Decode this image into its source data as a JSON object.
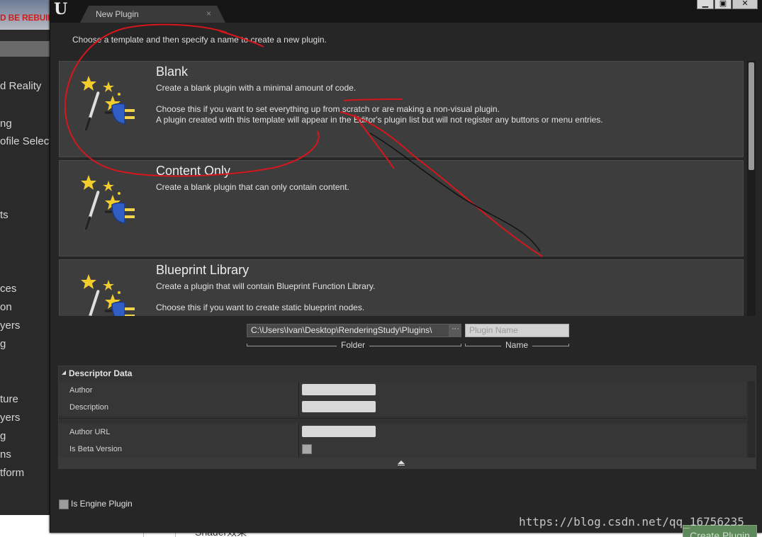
{
  "background": {
    "warning_text": "D BE REBUILT",
    "labels": [
      "d Reality",
      "ng",
      "ofile Select",
      "ts",
      "ces",
      "on",
      "yers",
      "g",
      "ture",
      "yers",
      "g",
      "ns",
      "tform"
    ],
    "below_text": "Shader效果"
  },
  "window": {
    "tab_title": "New Plugin",
    "tab_close": "×",
    "min_glyph": "▁",
    "max_glyph": "▣",
    "close_glyph": "✕",
    "logo": "U"
  },
  "instructions": "Choose a template and then specify a name to create a new plugin.",
  "templates": [
    {
      "name": "Blank",
      "description": "Create a blank plugin with a minimal amount of code.\n\nChoose this if you want to set everything up from scratch or are making a non-visual plugin.\nA plugin created with this template will appear in the Editor's plugin list but will not register any buttons or menu entries."
    },
    {
      "name": "Content Only",
      "description": "Create a blank plugin that can only contain content."
    },
    {
      "name": "Blueprint Library",
      "description": "Create a plugin that will contain Blueprint Function Library.\n\nChoose this if you want to create static blueprint nodes."
    }
  ],
  "plugin_path": {
    "folder_value": "C:\\Users\\Ivan\\Desktop\\RenderingStudy\\Plugins\\",
    "browse_label": "···",
    "name_placeholder": "Plugin Name",
    "folder_label": "Folder",
    "name_label": "Name"
  },
  "descriptor": {
    "title": "Descriptor Data",
    "fields": [
      {
        "label": "Author",
        "value": ""
      },
      {
        "label": "Description",
        "value": ""
      },
      {
        "label": "Author URL",
        "value": ""
      },
      {
        "label": "Is Beta Version",
        "checked": false
      }
    ]
  },
  "engine_plugin": {
    "label": "Is Engine Plugin",
    "checked": false
  },
  "create_button": "Create Plugin",
  "watermark": "https://blog.csdn.net/qq_16756235"
}
